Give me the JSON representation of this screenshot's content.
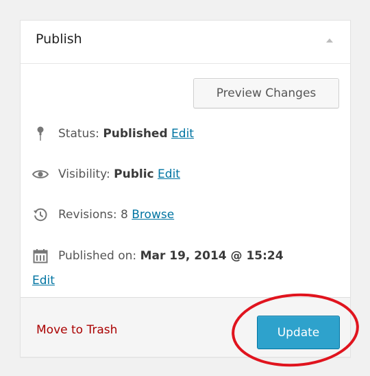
{
  "publish_box": {
    "title": "Publish",
    "preview_button": "Preview Changes",
    "status": {
      "label": "Status:",
      "value": "Published",
      "edit": "Edit"
    },
    "visibility": {
      "label": "Visibility:",
      "value": "Public",
      "edit": "Edit"
    },
    "revisions": {
      "label": "Revisions: 8",
      "link": "Browse"
    },
    "published_on": {
      "label": "Published on:",
      "value": "Mar 19, 2014 @ 15:24",
      "edit": "Edit"
    },
    "trash_link": "Move to Trash",
    "update_button": "Update"
  },
  "icons": {
    "collapse": "triangle-up-icon",
    "status": "pin-icon",
    "visibility": "eye-icon",
    "revisions": "history-icon",
    "published_on": "calendar-icon"
  },
  "colors": {
    "link": "#0074a2",
    "trash": "#aa0000",
    "update_button": "#2ea2cc",
    "annotation_circle": "#e0141e"
  }
}
